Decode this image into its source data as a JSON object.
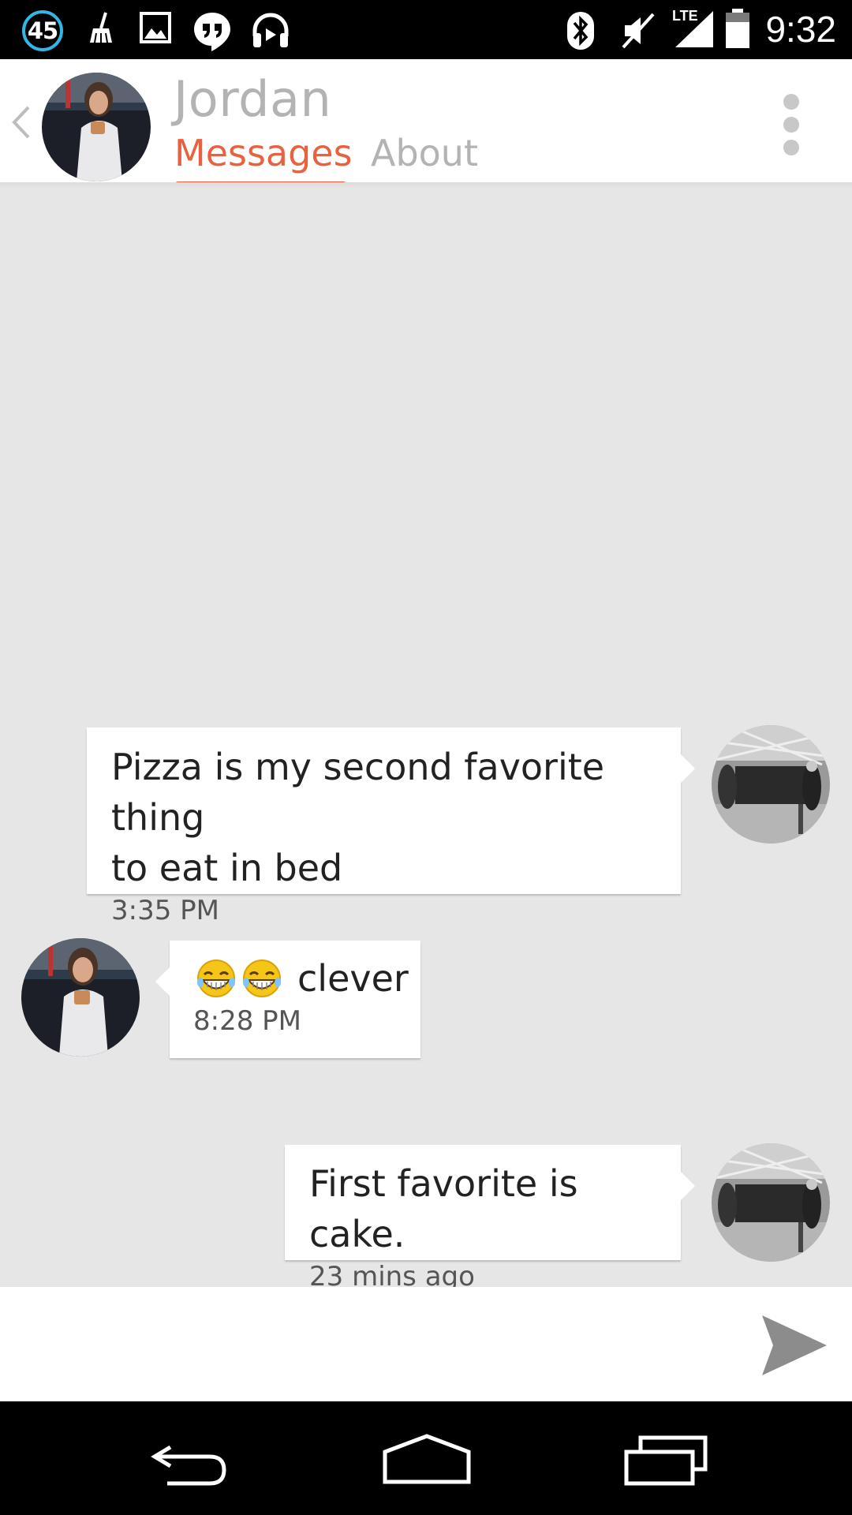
{
  "status_bar": {
    "notification_count": "45",
    "time": "9:32",
    "network": "LTE",
    "icons": [
      "notification-count-badge",
      "broom-icon",
      "image-icon",
      "hangouts-icon",
      "headphones-icon",
      "bluetooth-icon",
      "mute-icon",
      "lte-signal-icon",
      "battery-icon"
    ]
  },
  "header": {
    "contact_name": "Jordan",
    "tabs": [
      {
        "label": "Messages",
        "active": true
      },
      {
        "label": "About",
        "active": false
      }
    ],
    "accent_color": "#e8623f",
    "icons": [
      "back-icon",
      "overflow-menu-icon"
    ]
  },
  "messages": [
    {
      "direction": "outgoing",
      "lines": [
        "Pizza is my second favorite thing",
        "to eat in bed"
      ],
      "time": "3:35 PM"
    },
    {
      "direction": "incoming",
      "emoji": "😁😁",
      "text": "clever",
      "time": "8:28 PM"
    },
    {
      "direction": "outgoing",
      "lines": [
        "First favorite is cake."
      ],
      "time": "23 mins ago"
    }
  ],
  "compose": {
    "placeholder": "",
    "send_icon": "send-icon"
  },
  "nav_bar": {
    "icons": [
      "nav-back-icon",
      "nav-home-icon",
      "nav-recents-icon"
    ]
  }
}
